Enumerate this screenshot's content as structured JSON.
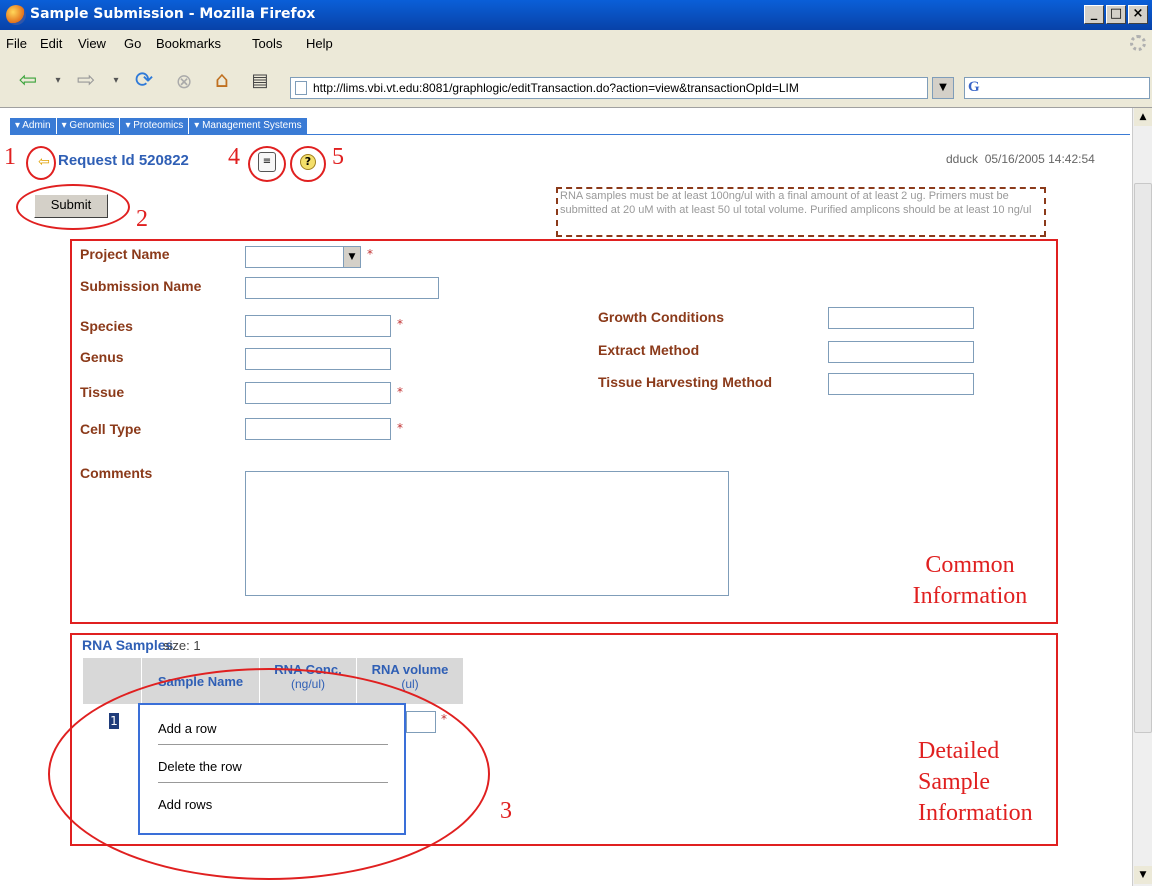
{
  "window": {
    "title": "Sample Submission - Mozilla Firefox",
    "min": "_",
    "max": "□",
    "close": "×"
  },
  "menu": [
    "File",
    "Edit",
    "View",
    "Go",
    "Bookmarks",
    "Tools",
    "Help"
  ],
  "url": "http://lims.vbi.vt.edu:8081/graphlogic/editTransaction.do?action=view&transactionOpId=LIM",
  "search_engine_icon": "G",
  "app_nav": [
    "Admin",
    "Genomics",
    "Proteomics",
    "Management Systems"
  ],
  "request": {
    "title": "Request Id 520822",
    "user": "dduck",
    "timestamp": "05/16/2005 14:42:54"
  },
  "submit_label": "Submit",
  "notice": "RNA samples must be at least 100ng/ul with a final amount of at least 2 ug. Primers must be submitted at 20 uM with at least 50 ul total volume. Purified amplicons should be at least 10 ng/ul",
  "form": {
    "project_name": "Project Name",
    "submission_name": "Submission Name",
    "species": "Species",
    "genus": "Genus",
    "tissue": "Tissue",
    "cell_type": "Cell Type",
    "comments": "Comments",
    "growth_conditions": "Growth Conditions",
    "extract_method": "Extract Method",
    "tissue_harvesting_method": "Tissue Harvesting Method",
    "required_mark": "*"
  },
  "rna": {
    "title": "RNA Samples",
    "size": "size: 1",
    "columns": [
      {
        "label": "Sample Name",
        "unit": ""
      },
      {
        "label": "RNA Conc.",
        "unit": "(ng/ul)"
      },
      {
        "label": "RNA volume",
        "unit": "(ul)"
      }
    ],
    "row_number": "1"
  },
  "context_menu": [
    "Add a row",
    "Delete the row",
    "Add rows"
  ],
  "annotations": {
    "n1": "1",
    "n2": "2",
    "n3": "3",
    "n4": "4",
    "n5": "5",
    "common": "Common Information",
    "detailed": "Detailed Sample Information"
  },
  "icons": {
    "back": "back-arrow-icon",
    "forward": "forward-arrow-icon",
    "reload": "reload-icon",
    "stop": "stop-icon",
    "home": "home-icon",
    "print": "print-icon",
    "report": "document-icon",
    "help": "help-icon"
  },
  "colors": {
    "accent": "#3a7bd5",
    "label": "#8b3a1a",
    "annotation": "#e02020",
    "title_blue": "#2f5fb5"
  }
}
